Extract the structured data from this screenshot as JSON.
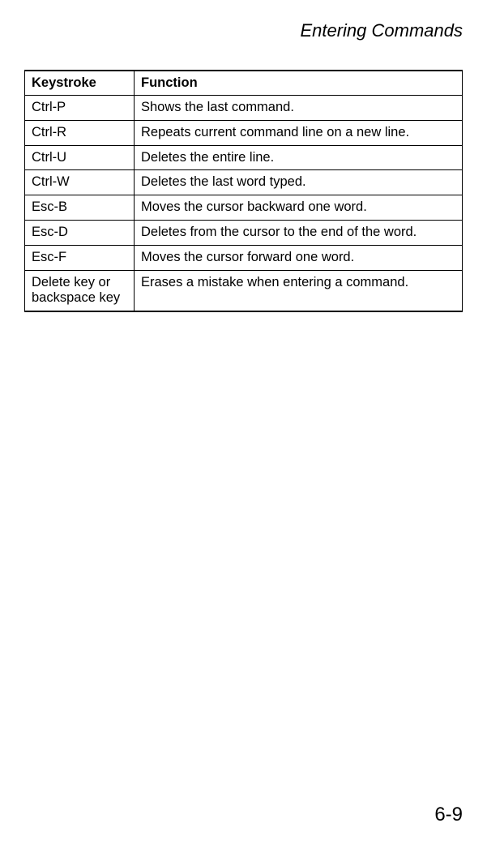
{
  "header": {
    "title": "Entering Commands"
  },
  "table": {
    "headers": {
      "keystroke": "Keystroke",
      "function": "Function"
    },
    "rows": [
      {
        "keystroke": "Ctrl-P",
        "function": "Shows the last command."
      },
      {
        "keystroke": "Ctrl-R",
        "function": "Repeats current command line on a new line."
      },
      {
        "keystroke": "Ctrl-U",
        "function": "Deletes the entire line."
      },
      {
        "keystroke": "Ctrl-W",
        "function": "Deletes the last word typed."
      },
      {
        "keystroke": "Esc-B",
        "function": "Moves the cursor backward one word."
      },
      {
        "keystroke": "Esc-D",
        "function": "Deletes from the cursor to the end of the word."
      },
      {
        "keystroke": "Esc-F",
        "function": "Moves the cursor forward one word."
      },
      {
        "keystroke": "Delete key or backspace key",
        "function": "Erases a mistake when entering a command."
      }
    ]
  },
  "footer": {
    "pageNumber": "6-9"
  }
}
